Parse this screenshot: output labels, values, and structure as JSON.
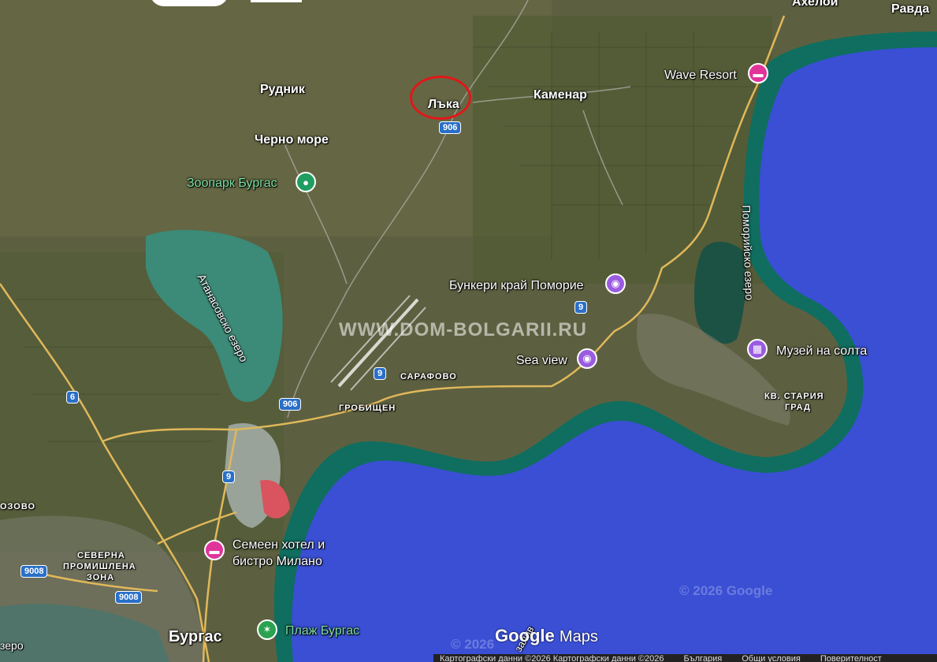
{
  "watermark": "WWW.DOM-BOLGARII.RU",
  "places": {
    "aheloy": "Ахелой",
    "ravda": "Равда",
    "rudnik": "Рудник",
    "laka": "Лъка",
    "kamenar": "Каменар",
    "cherno_more": "Черно море",
    "zoo": "Зоопарк Бургас",
    "wave_resort": "Wave Resort",
    "bunkeri": "Бункери край Поморие",
    "sea_view": "Sea view",
    "muzei": "Музей на солта",
    "sarafovo": "САРАФОВО",
    "grobishten": "ГРОБИЩЕН",
    "stariya_grad_1": "КВ. СТАРИЯ",
    "stariya_grad_2": "ГРАД",
    "semeen_1": "Семеен хотел и",
    "semeen_2": "бистро Милано",
    "burgas": "Бургас",
    "plaj": "Плаж Бургас",
    "severna_1": "СЕВЕРНА",
    "severna_2": "ПРОМИШЛЕНА",
    "severna_3": "ЗОНА",
    "ozovo": "ОЗОВО",
    "ezero_left": "зеро",
    "atanasovsko": "Атанасовско езеро",
    "pomoriysko": "Поморийско езеро",
    "zaliv": "залив"
  },
  "roads": {
    "r906a": "906",
    "r906b": "906",
    "r9a": "9",
    "r9b": "9",
    "r9c": "9",
    "r6": "6",
    "r9008a": "9008",
    "r9008b": "9008"
  },
  "attribution": {
    "logo_google": "Google",
    "logo_maps": "Maps",
    "copyright": "© 2026 Google",
    "copyright2": "© 2026",
    "footer_data": "Картографски данни ©2026  Картографски данни ©2026",
    "footer_country": "България",
    "footer_terms": "Общи условия",
    "footer_privacy": "Поверителност"
  },
  "colors": {
    "land": "#6b6d45",
    "sea": "#3b4fd6",
    "coast": "#0f6e5f",
    "road": "#e0b85a",
    "marker_circle": "#e01818"
  }
}
